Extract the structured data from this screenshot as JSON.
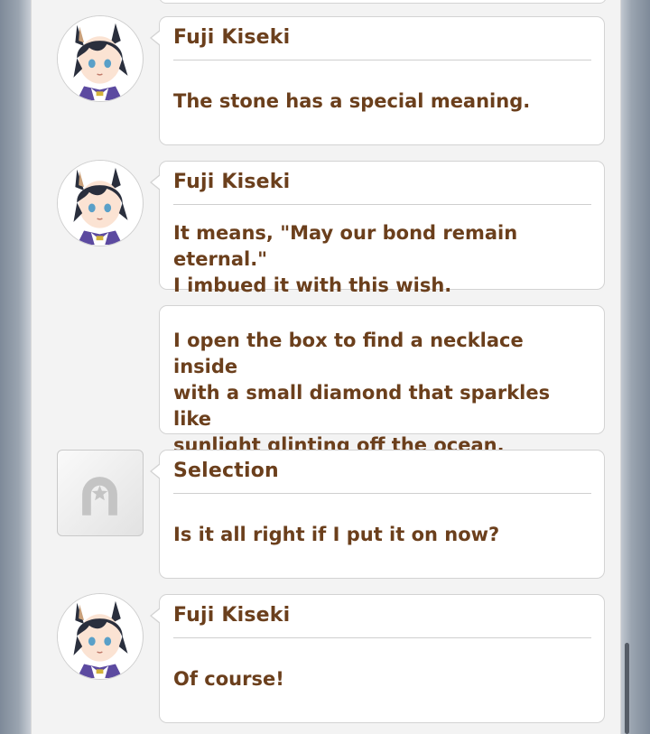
{
  "colors": {
    "text": "#6b3f1c",
    "bubble_bg": "#ffffff",
    "bubble_border": "#d3d3d3",
    "panel_bg": "#f3f3f3",
    "scroll_thumb": "#555c66"
  },
  "messages": [
    {
      "type": "dialogue",
      "avatar": "fuji-kiseki-portrait",
      "speaker": "Fuji Kiseki",
      "text": "The stone has a special meaning."
    },
    {
      "type": "dialogue",
      "avatar": "fuji-kiseki-portrait",
      "speaker": "Fuji Kiseki",
      "text": "It means, \"May our bond remain eternal.\"\nI imbued it with this wish."
    },
    {
      "type": "narration",
      "text": "I open the box to find a necklace inside\nwith a small diamond that sparkles like\nsunlight glinting off the ocean."
    },
    {
      "type": "selection",
      "avatar": "horseshoe-star-icon",
      "speaker": "Selection",
      "text": "Is it all right if I put it on now?"
    },
    {
      "type": "dialogue",
      "avatar": "fuji-kiseki-portrait",
      "speaker": "Fuji Kiseki",
      "text": "Of course!"
    }
  ]
}
